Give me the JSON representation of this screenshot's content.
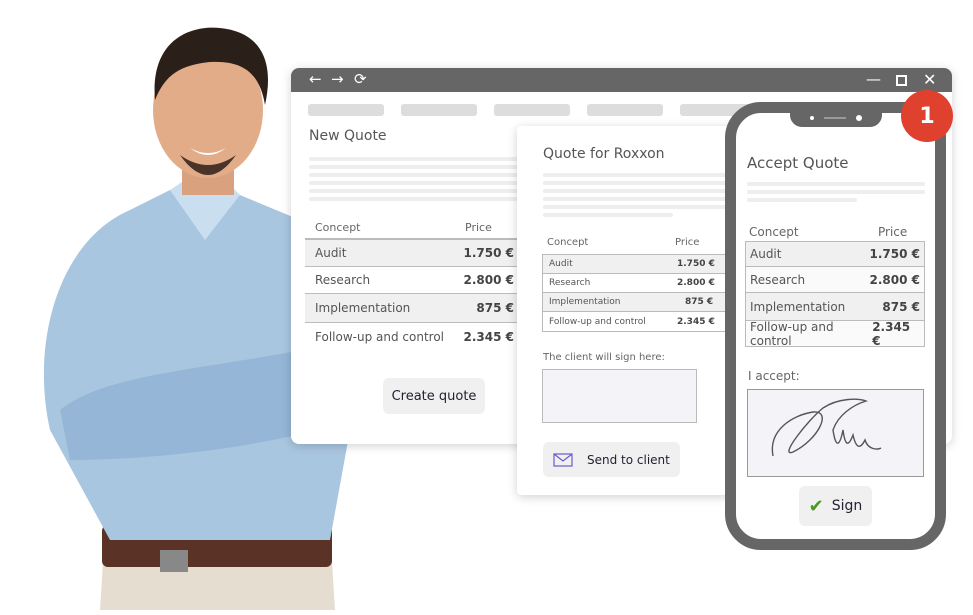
{
  "browser": {
    "nav_icons": [
      "back-arrow-icon",
      "forward-arrow-icon",
      "reload-icon"
    ],
    "window_icons": [
      "minimize-icon",
      "maximize-icon",
      "close-icon"
    ]
  },
  "new_quote": {
    "title": "New Quote",
    "headers": {
      "concept": "Concept",
      "price": "Price"
    },
    "rows": [
      {
        "concept": "Audit",
        "price": "1.750 €"
      },
      {
        "concept": "Research",
        "price": "2.800 €"
      },
      {
        "concept": "Implementation",
        "price": "875 €"
      },
      {
        "concept": "Follow-up and control",
        "price": "2.345 €"
      }
    ],
    "create_button": "Create quote"
  },
  "client_quote": {
    "title": "Quote for Roxxon",
    "headers": {
      "concept": "Concept",
      "price": "Price"
    },
    "rows": [
      {
        "concept": "Audit",
        "price": "1.750 €"
      },
      {
        "concept": "Research",
        "price": "2.800 €"
      },
      {
        "concept": "Implementation",
        "price": "875 €"
      },
      {
        "concept": "Follow-up and control",
        "price": "2.345 €"
      }
    ],
    "sign_label": "The client will sign here:",
    "send_button": "Send to client"
  },
  "phone": {
    "title": "Accept Quote",
    "headers": {
      "concept": "Concept",
      "price": "Price"
    },
    "rows": [
      {
        "concept": "Audit",
        "price": "1.750 €"
      },
      {
        "concept": "Research",
        "price": "2.800 €"
      },
      {
        "concept": "Implementation",
        "price": "875 €"
      },
      {
        "concept": "Follow-up and control",
        "price": "2.345 €"
      }
    ],
    "accept_label": "I accept:",
    "sign_button": "Sign"
  },
  "badge": "1",
  "colors": {
    "badge": "#e0412f",
    "chrome": "#666666",
    "check": "#4a9a1e",
    "envelope": "#6a5acd"
  }
}
